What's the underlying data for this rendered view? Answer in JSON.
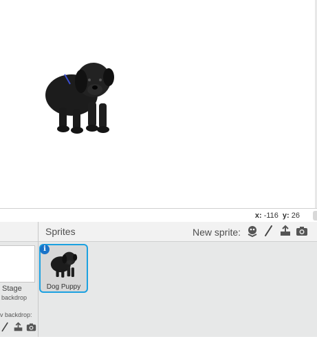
{
  "coordinates": {
    "x_label": "x:",
    "x_value": "-116",
    "y_label": "y:",
    "y_value": "26"
  },
  "stage_panel": {
    "stage_label": "Stage",
    "backdrop_count": "backdrop",
    "new_backdrop_label": "v backdrop:"
  },
  "sprites_panel": {
    "title": "Sprites",
    "new_sprite_label": "New sprite:",
    "sprites": [
      {
        "name": "Dog Puppy",
        "info": "i",
        "selected": true
      }
    ]
  },
  "icons": {
    "new_sprite": [
      "library-sprite-icon",
      "paint-brush-icon",
      "upload-icon",
      "camera-icon"
    ],
    "new_backdrop": [
      "paint-brush-icon",
      "upload-icon",
      "camera-icon"
    ]
  },
  "colors": {
    "selection": "#1aa0e0",
    "info_badge": "#1a73c8",
    "panel_bg": "#e7e8e8"
  }
}
